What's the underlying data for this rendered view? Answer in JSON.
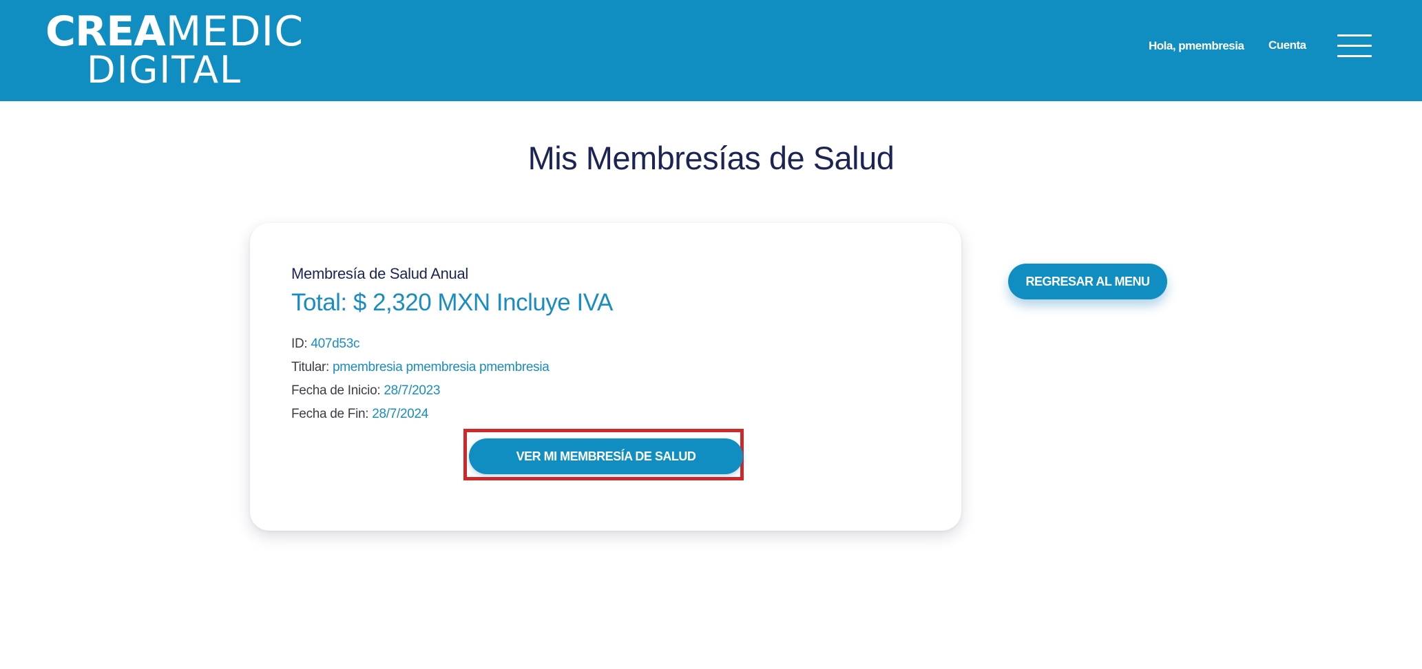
{
  "header": {
    "logo": {
      "line1_bold": "CREA",
      "line1_light": "MEDIC",
      "line2": "DIGITAL"
    },
    "greeting": "Hola, pmembresia",
    "account_link": "Cuenta",
    "menu_icon": "hamburger-menu-icon",
    "background_color": "#108dc1"
  },
  "page": {
    "title": "Mis Membresías de Salud"
  },
  "membership_card": {
    "plan_name": "Membresía de Salud Anual",
    "total": "Total: $ 2,320 MXN Incluye IVA",
    "details": {
      "id_label": "ID: ",
      "id_value": "407d53c",
      "holder_label": "Titular: ",
      "holder_value": "pmembresia pmembresia pmembresia",
      "start_label": "Fecha de Inicio: ",
      "start_value": "28/7/2023",
      "end_label": "Fecha de Fin: ",
      "end_value": "28/7/2024"
    },
    "view_button": "VER MI MEMBRESÍA DE SALUD"
  },
  "back_button": "REGRESAR AL MENU",
  "colors": {
    "accent": "#108dc1",
    "title": "#1c2452",
    "highlight_border": "#cc2a2a"
  }
}
